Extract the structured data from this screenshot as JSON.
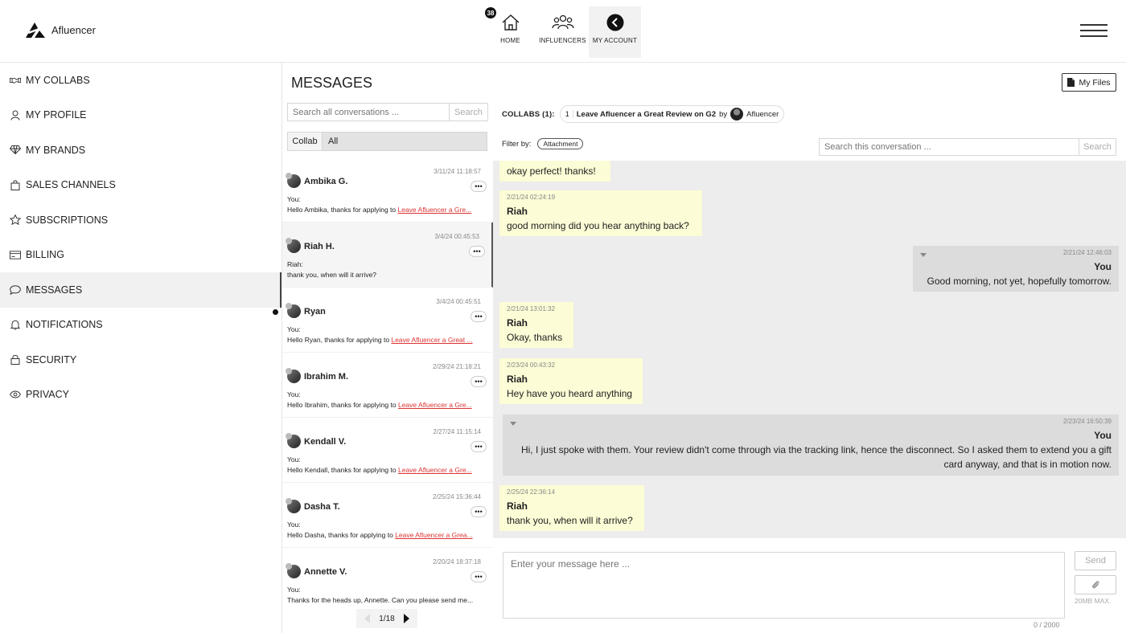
{
  "brand": {
    "name": "Afluencer"
  },
  "nav": {
    "badge": "38",
    "items": [
      {
        "label": "HOME",
        "icon": "home-icon"
      },
      {
        "label": "INFLUENCERS",
        "icon": "people-icon"
      },
      {
        "label": "MY ACCOUNT",
        "icon": "back-arrow-icon"
      }
    ]
  },
  "sidebar": {
    "items": [
      {
        "label": "MY COLLABS",
        "icon": "handshake-icon"
      },
      {
        "label": "MY PROFILE",
        "icon": "user-icon"
      },
      {
        "label": "MY BRANDS",
        "icon": "diamond-icon"
      },
      {
        "label": "SALES CHANNELS",
        "icon": "shopping-bag-icon"
      },
      {
        "label": "SUBSCRIPTIONS",
        "icon": "star-icon"
      },
      {
        "label": "BILLING",
        "icon": "card-icon"
      },
      {
        "label": "MESSAGES",
        "icon": "chat-bubble-icon"
      },
      {
        "label": "NOTIFICATIONS",
        "icon": "bell-icon"
      },
      {
        "label": "SECURITY",
        "icon": "lock-icon"
      },
      {
        "label": "PRIVACY",
        "icon": "eye-icon"
      }
    ]
  },
  "messages": {
    "title": "MESSAGES",
    "search_placeholder": "Search all conversations ...",
    "search_button": "Search",
    "filter_label": "Collab",
    "filter_value": "All",
    "conversations": [
      {
        "name": "Ambika G.",
        "time": "3/11/24 11:18:57",
        "who": "You:",
        "snippet": "Hello Ambika, thanks for applying to ",
        "link": "Leave Afluencer a Gre..."
      },
      {
        "name": "Riah H.",
        "time": "3/4/24 00:45:53",
        "who": "Riah:",
        "snippet": "thank you, when will it arrive?",
        "link": ""
      },
      {
        "name": "Ryan",
        "time": "3/4/24 00:45:51",
        "who": "You:",
        "snippet": "Hello Ryan, thanks for applying to ",
        "link": "Leave Afluencer a Great ..."
      },
      {
        "name": "Ibrahim M.",
        "time": "2/29/24 21:18:21",
        "who": "You:",
        "snippet": "Hello Ibrahim, thanks for applying to ",
        "link": "Leave Afluencer a Gre..."
      },
      {
        "name": "Kendall V.",
        "time": "2/27/24 11:15:14",
        "who": "You:",
        "snippet": "Hello Kendall, thanks for applying to ",
        "link": "Leave Afluencer a Gre..."
      },
      {
        "name": "Dasha T.",
        "time": "2/25/24 15:36:44",
        "who": "You:",
        "snippet": "Hello Dasha, thanks for applying to ",
        "link": "Leave Afluencer a Grea..."
      },
      {
        "name": "Annette V.",
        "time": "2/20/24 18:37:18",
        "who": "You:",
        "snippet": "Thanks for the heads up, Annette. Can you please send me...",
        "link": ""
      }
    ],
    "more_label": "•••",
    "pager": "1/18"
  },
  "chat": {
    "my_files": "My Files",
    "collabs_label": "COLLABS (1):",
    "collab_num": "1",
    "collab_title": "Leave Afluencer a Great Review on G2",
    "collab_by": "by",
    "collab_owner": "Afluencer",
    "filter_by": "Filter by:",
    "attachment_chip": "Attachment",
    "search_placeholder": "Search this conversation ...",
    "search_button": "Search",
    "messages": [
      {
        "dir": "in",
        "time": "",
        "name": "",
        "text": "okay perfect! thanks!"
      },
      {
        "dir": "in",
        "time": "2/21/24 02:24:19",
        "name": "Riah",
        "text": "good morning did you hear anything back?"
      },
      {
        "dir": "out",
        "time": "2/21/24 12:46:03",
        "name": "You",
        "text": "Good morning, not yet, hopefully tomorrow."
      },
      {
        "dir": "in",
        "time": "2/21/24 13:01:32",
        "name": "Riah",
        "text": "Okay, thanks"
      },
      {
        "dir": "in",
        "time": "2/23/24 00:43:32",
        "name": "Riah",
        "text": "Hey have you heard anything"
      },
      {
        "dir": "out",
        "time": "2/23/24 16:50:39",
        "name": "You",
        "text": "Hi, I just spoke with them. Your review didn't come through via the tracking link, hence the disconnect. So I asked them to extend you a gift card anyway, and that is in motion now."
      },
      {
        "dir": "in",
        "time": "2/25/24 22:36:14",
        "name": "Riah",
        "text": "thank you, when will it arrive?"
      }
    ],
    "composer_placeholder": "Enter your message here ...",
    "counter": "0 / 2000",
    "send": "Send",
    "max_size": "20MB MAX."
  }
}
